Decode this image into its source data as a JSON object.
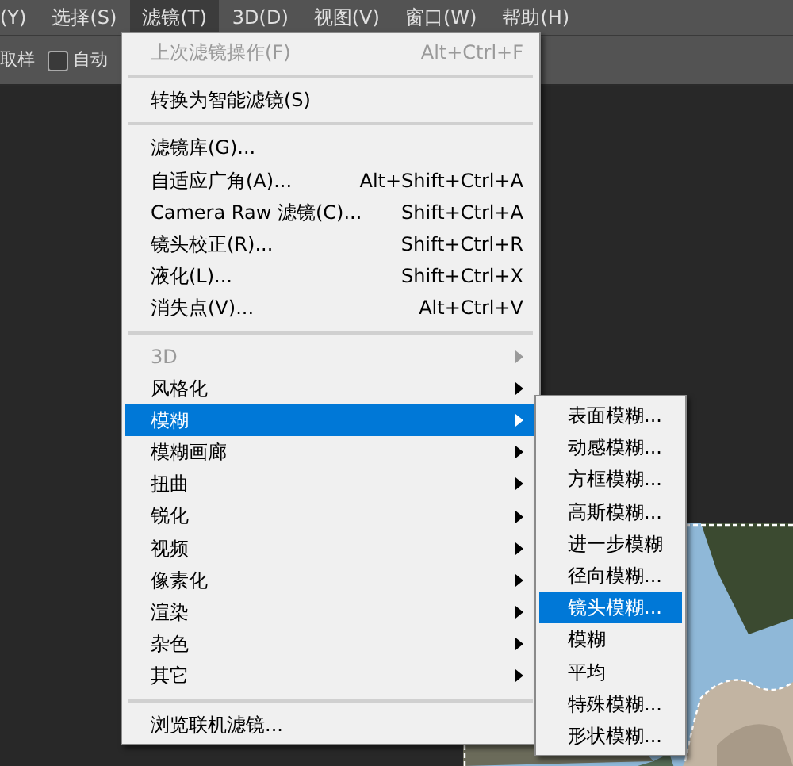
{
  "menubar": [
    {
      "label": "(Y)",
      "selected": false
    },
    {
      "label": "选择(S)",
      "selected": false
    },
    {
      "label": "滤镜(T)",
      "selected": true
    },
    {
      "label": "3D(D)",
      "selected": false
    },
    {
      "label": "视图(V)",
      "selected": false
    },
    {
      "label": "窗口(W)",
      "selected": false
    },
    {
      "label": "帮助(H)",
      "selected": false
    }
  ],
  "options_bar": {
    "sample_label": "取样",
    "auto_checkbox": {
      "label": "自动",
      "checked": false
    }
  },
  "filter_menu": [
    {
      "kind": "item",
      "label": "上次滤镜操作(F)",
      "shortcut": "Alt+Ctrl+F",
      "disabled": true,
      "submenu": false,
      "selected": false
    },
    {
      "kind": "separator"
    },
    {
      "kind": "item",
      "label": "转换为智能滤镜(S)",
      "disabled": false,
      "submenu": false,
      "selected": false
    },
    {
      "kind": "separator"
    },
    {
      "kind": "item",
      "label": "滤镜库(G)...",
      "disabled": false,
      "submenu": false,
      "selected": false
    },
    {
      "kind": "item",
      "label": "自适应广角(A)...",
      "shortcut": "Alt+Shift+Ctrl+A",
      "disabled": false,
      "submenu": false,
      "selected": false
    },
    {
      "kind": "item",
      "label": "Camera Raw 滤镜(C)...",
      "shortcut": "Shift+Ctrl+A",
      "disabled": false,
      "submenu": false,
      "selected": false
    },
    {
      "kind": "item",
      "label": "镜头校正(R)...",
      "shortcut": "Shift+Ctrl+R",
      "disabled": false,
      "submenu": false,
      "selected": false
    },
    {
      "kind": "item",
      "label": "液化(L)...",
      "shortcut": "Shift+Ctrl+X",
      "disabled": false,
      "submenu": false,
      "selected": false
    },
    {
      "kind": "item",
      "label": "消失点(V)...",
      "shortcut": "Alt+Ctrl+V",
      "disabled": false,
      "submenu": false,
      "selected": false
    },
    {
      "kind": "separator"
    },
    {
      "kind": "item",
      "label": "3D",
      "disabled": true,
      "submenu": true,
      "selected": false
    },
    {
      "kind": "item",
      "label": "风格化",
      "disabled": false,
      "submenu": true,
      "selected": false
    },
    {
      "kind": "item",
      "label": "模糊",
      "disabled": false,
      "submenu": true,
      "selected": true
    },
    {
      "kind": "item",
      "label": "模糊画廊",
      "disabled": false,
      "submenu": true,
      "selected": false
    },
    {
      "kind": "item",
      "label": "扭曲",
      "disabled": false,
      "submenu": true,
      "selected": false
    },
    {
      "kind": "item",
      "label": "锐化",
      "disabled": false,
      "submenu": true,
      "selected": false
    },
    {
      "kind": "item",
      "label": "视频",
      "disabled": false,
      "submenu": true,
      "selected": false
    },
    {
      "kind": "item",
      "label": "像素化",
      "disabled": false,
      "submenu": true,
      "selected": false
    },
    {
      "kind": "item",
      "label": "渲染",
      "disabled": false,
      "submenu": true,
      "selected": false
    },
    {
      "kind": "item",
      "label": "杂色",
      "disabled": false,
      "submenu": true,
      "selected": false
    },
    {
      "kind": "item",
      "label": "其它",
      "disabled": false,
      "submenu": true,
      "selected": false
    },
    {
      "kind": "separator"
    },
    {
      "kind": "item",
      "label": "浏览联机滤镜...",
      "disabled": false,
      "submenu": false,
      "selected": false
    }
  ],
  "blur_submenu": [
    {
      "label": "表面模糊...",
      "selected": false
    },
    {
      "label": "动感模糊...",
      "selected": false
    },
    {
      "label": "方框模糊...",
      "selected": false
    },
    {
      "label": "高斯模糊...",
      "selected": false
    },
    {
      "label": "进一步模糊",
      "selected": false
    },
    {
      "label": "径向模糊...",
      "selected": false
    },
    {
      "label": "镜头模糊...",
      "selected": true
    },
    {
      "label": "模糊",
      "selected": false
    },
    {
      "label": "平均",
      "selected": false
    },
    {
      "label": "特殊模糊...",
      "selected": false
    },
    {
      "label": "形状模糊...",
      "selected": false
    }
  ]
}
